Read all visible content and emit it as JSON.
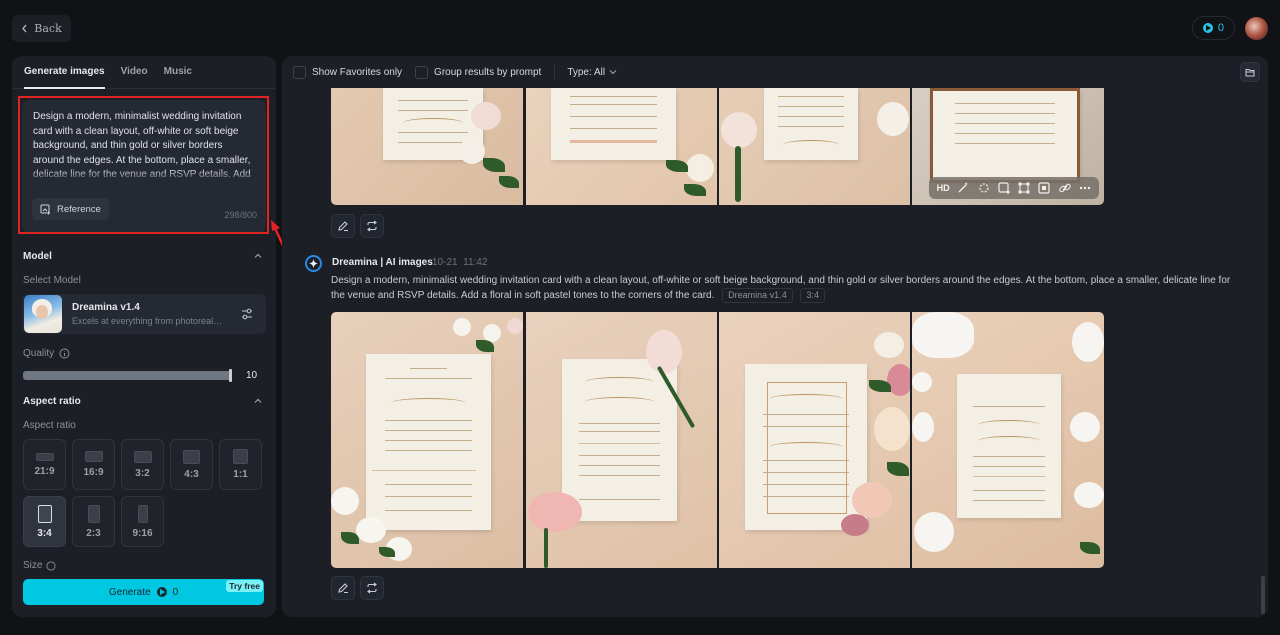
{
  "topbar": {
    "back_label": "Back",
    "credits": "0",
    "avatar_alt": "user-avatar"
  },
  "left_panel": {
    "tabs": [
      {
        "label": "Generate images",
        "active": true
      },
      {
        "label": "Video",
        "active": false
      },
      {
        "label": "Music",
        "active": false
      }
    ],
    "prompt": {
      "text": "Design a modern, minimalist wedding invitation card with a clean layout, off-white or soft beige background, and thin gold or silver borders around the edges. At the bottom, place a smaller, delicate line for the venue and RSVP details. Add a floral in soft pastel tones to the corners of the card.",
      "reference_label": "Reference",
      "char_count": "298/800"
    },
    "model_section": {
      "title": "Model",
      "select_label": "Select Model",
      "model_name": "Dreamina v1.4",
      "model_desc": "Excels at everything from photorealism to painterly styles"
    },
    "quality": {
      "label": "Quality",
      "value": "10",
      "fraction": 1.0
    },
    "aspect_section": {
      "title": "Aspect ratio",
      "sub_label": "Aspect ratio",
      "options": [
        {
          "label": "21:9",
          "selected": false
        },
        {
          "label": "16:9",
          "selected": false
        },
        {
          "label": "3:2",
          "selected": false
        },
        {
          "label": "4:3",
          "selected": false
        },
        {
          "label": "1:1",
          "selected": false
        },
        {
          "label": "3:4",
          "selected": true
        },
        {
          "label": "2:3",
          "selected": false
        },
        {
          "label": "9:16",
          "selected": false
        }
      ]
    },
    "size_label": "Size",
    "generate": {
      "label": "Generate",
      "credits": "0",
      "badge": "Try free"
    }
  },
  "main_panel": {
    "filters": {
      "favorites_label": "Show Favorites only",
      "group_label": "Group results by prompt",
      "type_label": "Type: All"
    },
    "image_toolbar": {
      "items": [
        "HD",
        "retouch-icon",
        "inpaint-icon",
        "expand-icon",
        "resize-icon",
        "remove-bg-icon",
        "link-icon",
        "more-icon"
      ]
    },
    "generation": {
      "author": "Dreamina | AI images",
      "date": "10-21",
      "time": "11:42",
      "prompt": "Design a modern, minimalist wedding invitation card with a clean layout, off-white or soft beige background, and thin gold or silver borders around the edges. At the bottom, place a smaller, delicate line for the venue and RSVP details. Add a floral in soft pastel tones to the corners of the card.",
      "model_tag": "Dreamina v1.4",
      "ratio_tag": "3:4",
      "images": [
        {
          "alt": "Wedding invitation with white roses, script heading"
        },
        {
          "alt": "Wedding invitation with pink rose and single stem"
        },
        {
          "alt": "Gold-bordered invitation with pink and cream roses"
        },
        {
          "alt": "Floral-corner invitation with white flowers and plates"
        }
      ]
    },
    "previous_generation": {
      "images": [
        {
          "alt": "Invitation with gold floral corners and roses"
        },
        {
          "alt": "Invitation with pastel floral border"
        },
        {
          "alt": "Invitation with pale roses"
        },
        {
          "alt": "Gold framed invitation with white roses"
        }
      ]
    }
  },
  "colors": {
    "accent": "#00c8e0",
    "background": "#111215",
    "panel": "#1c1f26",
    "annotation": "#e02424"
  }
}
